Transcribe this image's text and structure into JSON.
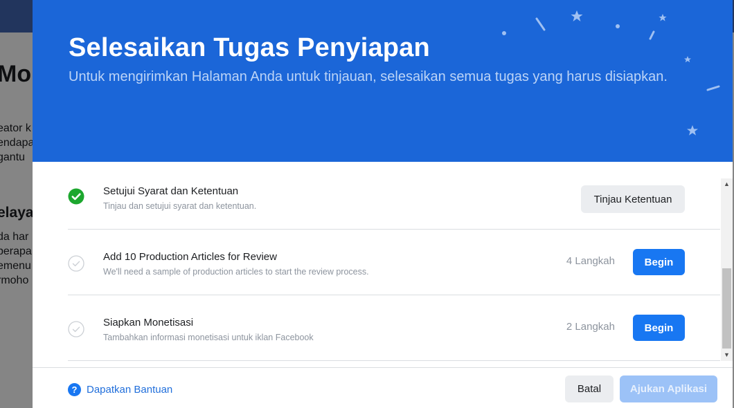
{
  "background_page": {
    "heading": "Mon",
    "paragraph1": [
      "eator k",
      "endapa",
      "gantu"
    ],
    "subheading": "elayak",
    "paragraph2": [
      "da har",
      "berapa",
      "emenu",
      "rmoho"
    ]
  },
  "modal": {
    "title": "Selesaikan Tugas Penyiapan",
    "subtitle": "Untuk mengirimkan Halaman Anda untuk tinjauan, selesaikan semua tugas yang harus disiapkan.",
    "tasks": [
      {
        "title": "Setujui Syarat dan Ketentuan",
        "description": "Tinjau dan setujui syarat dan ketentuan.",
        "status": "completed",
        "button_label": "Tinjau Ketentuan"
      },
      {
        "title": "Add 10 Production Articles for Review",
        "description": "We'll need a sample of production articles to start the review process.",
        "status": "pending",
        "steps": "4 Langkah",
        "button_label": "Begin"
      },
      {
        "title": "Siapkan Monetisasi",
        "description": "Tambahkan informasi monetisasi untuk iklan Facebook",
        "status": "pending",
        "steps": "2 Langkah",
        "button_label": "Begin"
      }
    ],
    "footer": {
      "help_label": "Dapatkan Bantuan",
      "cancel_label": "Batal",
      "submit_label": "Ajukan Aplikasi"
    }
  },
  "icons": {
    "completed": "check-circle-icon",
    "pending": "check-circle-outline-icon",
    "help": "question-circle-icon",
    "scroll_up": "scroll-up-arrow-icon",
    "scroll_down": "scroll-down-arrow-icon"
  },
  "colors": {
    "header_blue": "#1b66d8",
    "primary_button": "#1877f2",
    "completed_green": "#1ca72e",
    "disabled_button": "#9cc2f7"
  }
}
